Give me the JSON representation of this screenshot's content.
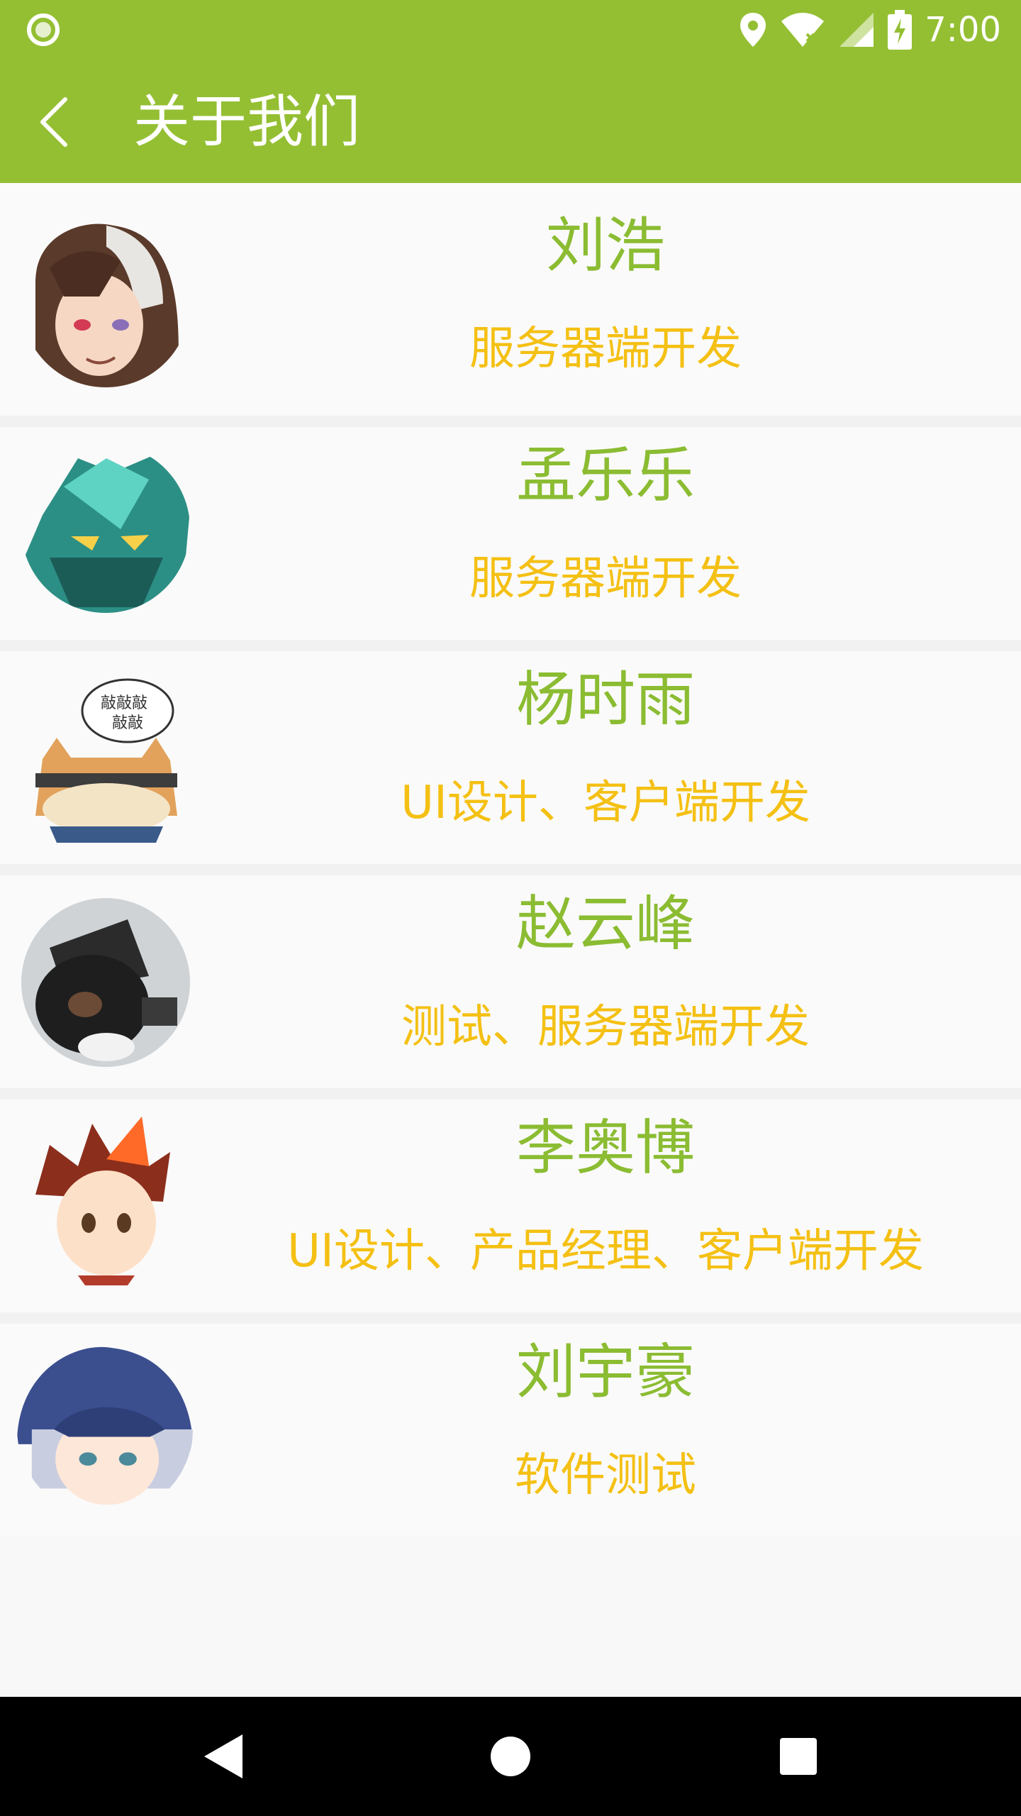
{
  "status_bar": {
    "time": "7:00",
    "icons": [
      "ring-icon",
      "location-icon",
      "wifi-icon",
      "signal-icon",
      "battery-charging-icon"
    ]
  },
  "app_bar": {
    "title": "关于我们",
    "back_icon": "back-arrow-icon"
  },
  "team": [
    {
      "name": "刘浩",
      "role": "服务器端开发",
      "avatar": "avatar-long-hair-character"
    },
    {
      "name": "孟乐乐",
      "role": "服务器端开发",
      "avatar": "avatar-green-robot"
    },
    {
      "name": "杨时雨",
      "role": "UI设计、客户端开发",
      "avatar": "avatar-cartoon-cat"
    },
    {
      "name": "赵云峰",
      "role": "测试、服务器端开发",
      "avatar": "avatar-bear-with-hat"
    },
    {
      "name": "李奥博",
      "role": "UI设计、产品经理、客户端开发",
      "avatar": "avatar-red-hair-boy"
    },
    {
      "name": "刘宇豪",
      "role": "软件测试",
      "avatar": "avatar-blue-hair-boy"
    }
  ],
  "nav_bar": {
    "icons": [
      "nav-back-icon",
      "nav-home-icon",
      "nav-recents-icon"
    ]
  },
  "colors": {
    "primary": "#94bf33",
    "name_text": "#8bbc32",
    "role_text": "#f4c013",
    "background": "#fafafa"
  }
}
